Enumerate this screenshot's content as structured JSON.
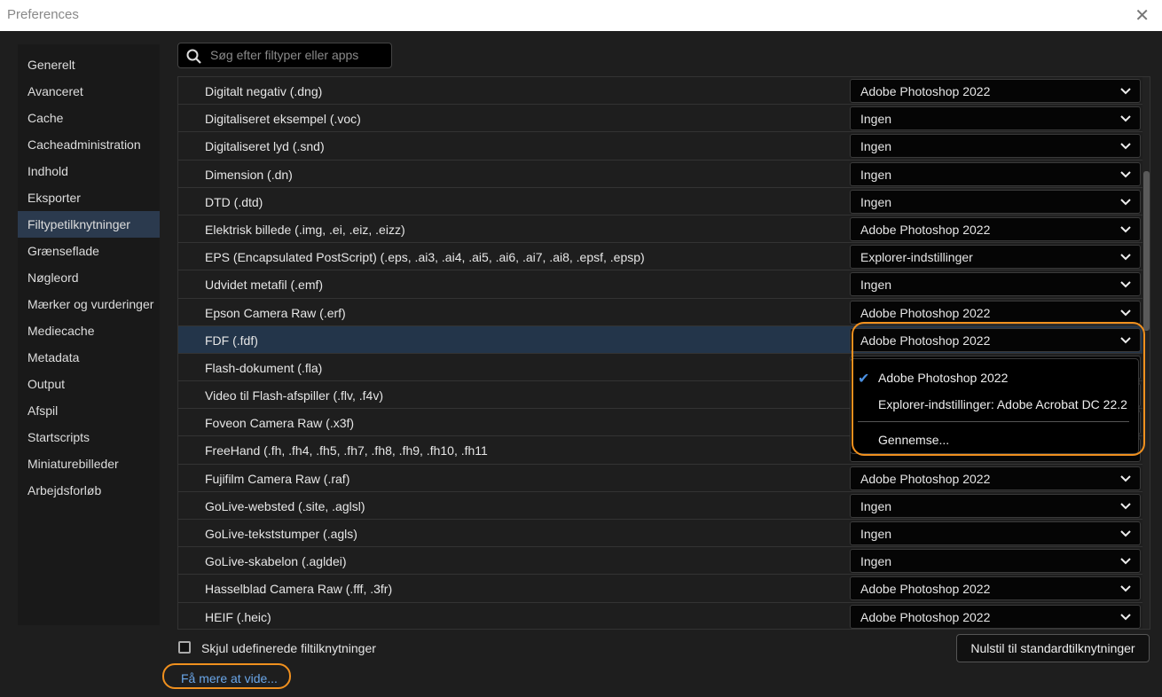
{
  "window": {
    "title": "Preferences",
    "close_icon": "close-icon"
  },
  "sidebar": {
    "items": [
      "Generelt",
      "Avanceret",
      "Cache",
      "Cacheadministration",
      "Indhold",
      "Eksporter",
      "Filtypetilknytninger",
      "Grænseflade",
      "Nøgleord",
      "Mærker og vurderinger",
      "Mediecache",
      "Metadata",
      "Output",
      "Afspil",
      "Startscripts",
      "Miniaturebilleder",
      "Arbejdsforløb"
    ],
    "active": "Filtypetilknytninger"
  },
  "search": {
    "placeholder": "Søg efter filtyper eller apps",
    "value": ""
  },
  "rows": [
    {
      "name": "Digitalt negativ (.dng)",
      "value": "Adobe Photoshop 2022"
    },
    {
      "name": "Digitaliseret eksempel (.voc)",
      "value": "Ingen"
    },
    {
      "name": "Digitaliseret lyd (.snd)",
      "value": "Ingen"
    },
    {
      "name": "Dimension (.dn)",
      "value": "Ingen"
    },
    {
      "name": "DTD (.dtd)",
      "value": "Ingen"
    },
    {
      "name": "Elektrisk billede (.img, .ei, .eiz, .eizz)",
      "value": "Adobe Photoshop 2022"
    },
    {
      "name": "EPS (Encapsulated PostScript) (.eps, .ai3, .ai4, .ai5, .ai6, .ai7, .ai8, .epsf, .epsp)",
      "value": "Explorer-indstillinger"
    },
    {
      "name": "Udvidet metafil (.emf)",
      "value": "Ingen"
    },
    {
      "name": "Epson Camera Raw (.erf)",
      "value": "Adobe Photoshop 2022"
    },
    {
      "name": "FDF (.fdf)",
      "value": "Adobe Photoshop 2022",
      "selected": true
    },
    {
      "name": "Flash-dokument (.fla)",
      "value": ""
    },
    {
      "name": "Video til Flash-afspiller (.flv, .f4v)",
      "value": ""
    },
    {
      "name": "Foveon Camera Raw (.x3f)",
      "value": ""
    },
    {
      "name": "FreeHand (.fh, .fh4, .fh5, .fh7, .fh8, .fh9, .fh10, .fh11",
      "value": ""
    },
    {
      "name": "Fujifilm Camera Raw (.raf)",
      "value": "Adobe Photoshop 2022"
    },
    {
      "name": "GoLive-websted (.site, .aglsl)",
      "value": "Ingen"
    },
    {
      "name": "GoLive-tekststumper (.agls)",
      "value": "Ingen"
    },
    {
      "name": "GoLive-skabelon (.agldei)",
      "value": "Ingen"
    },
    {
      "name": "Hasselblad Camera Raw (.fff, .3fr)",
      "value": "Adobe Photoshop 2022"
    },
    {
      "name": "HEIF (.heic)",
      "value": "Adobe Photoshop 2022"
    }
  ],
  "menu": {
    "items": [
      "Adobe Photoshop 2022",
      "Explorer-indstillinger: Adobe Acrobat DC 22.2",
      "Gennemse..."
    ],
    "checked": "Adobe Photoshop 2022"
  },
  "footer": {
    "checkbox_label": "Skjul udefinerede filtilknytninger",
    "checked": false,
    "link": "Få mere at vide...",
    "reset_button": "Nulstil til standardtilknytninger"
  },
  "colors": {
    "highlight": "#f0901e",
    "link": "#6aa6e8",
    "selected_row": "#23354a"
  }
}
